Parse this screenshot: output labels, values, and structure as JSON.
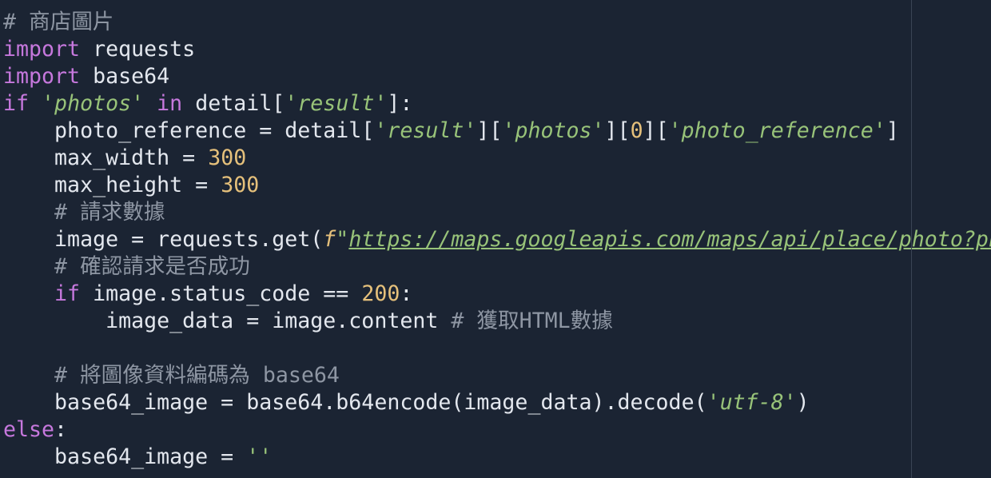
{
  "editor": {
    "lines": [
      [
        {
          "t": "# 商店圖片",
          "c": "comment"
        }
      ],
      [
        {
          "t": "import",
          "c": "kw"
        },
        {
          "t": " requests",
          "c": "plain"
        }
      ],
      [
        {
          "t": "import",
          "c": "kw"
        },
        {
          "t": " base64",
          "c": "plain"
        }
      ],
      [
        {
          "t": "if",
          "c": "kw"
        },
        {
          "t": " ",
          "c": "plain"
        },
        {
          "t": "'photos'",
          "c": "str"
        },
        {
          "t": " ",
          "c": "plain"
        },
        {
          "t": "in",
          "c": "kw"
        },
        {
          "t": " detail[",
          "c": "plain"
        },
        {
          "t": "'result'",
          "c": "str"
        },
        {
          "t": "]:",
          "c": "plain"
        }
      ],
      [
        {
          "t": "    photo_reference = detail[",
          "c": "plain"
        },
        {
          "t": "'result'",
          "c": "str"
        },
        {
          "t": "][",
          "c": "plain"
        },
        {
          "t": "'photos'",
          "c": "str"
        },
        {
          "t": "][",
          "c": "plain"
        },
        {
          "t": "0",
          "c": "num"
        },
        {
          "t": "][",
          "c": "plain"
        },
        {
          "t": "'photo_reference'",
          "c": "str"
        },
        {
          "t": "]",
          "c": "plain"
        }
      ],
      [
        {
          "t": "    max_width = ",
          "c": "plain"
        },
        {
          "t": "300",
          "c": "num"
        }
      ],
      [
        {
          "t": "    max_height = ",
          "c": "plain"
        },
        {
          "t": "300",
          "c": "num"
        }
      ],
      [
        {
          "t": "    ",
          "c": "plain"
        },
        {
          "t": "# 請求數據",
          "c": "comment"
        }
      ],
      [
        {
          "t": "    image = requests.get(",
          "c": "plain"
        },
        {
          "t": "f",
          "c": "fpre"
        },
        {
          "t": "\"",
          "c": "str"
        },
        {
          "t": "https://maps.googleapis.com/maps/api/place/photo?pho",
          "c": "fstr"
        }
      ],
      [
        {
          "t": "    ",
          "c": "plain"
        },
        {
          "t": "# 確認請求是否成功",
          "c": "comment"
        }
      ],
      [
        {
          "t": "    ",
          "c": "plain"
        },
        {
          "t": "if",
          "c": "kw"
        },
        {
          "t": " image.status_code == ",
          "c": "plain"
        },
        {
          "t": "200",
          "c": "num"
        },
        {
          "t": ":",
          "c": "plain"
        }
      ],
      [
        {
          "t": "        image_data = image.content ",
          "c": "plain"
        },
        {
          "t": "# 獲取HTML數據",
          "c": "comment"
        }
      ],
      [
        {
          "t": "",
          "c": "plain"
        }
      ],
      [
        {
          "t": "    ",
          "c": "plain"
        },
        {
          "t": "# 將圖像資料編碼為 base64",
          "c": "comment"
        }
      ],
      [
        {
          "t": "    base64_image = base64.b64encode(image_data).decode(",
          "c": "plain"
        },
        {
          "t": "'utf-8'",
          "c": "str"
        },
        {
          "t": ")",
          "c": "plain"
        }
      ],
      [
        {
          "t": "else",
          "c": "kw"
        },
        {
          "t": ":",
          "c": "plain"
        }
      ],
      [
        {
          "t": "    base64_image = ",
          "c": "plain"
        },
        {
          "t": "''",
          "c": "str"
        }
      ]
    ]
  }
}
